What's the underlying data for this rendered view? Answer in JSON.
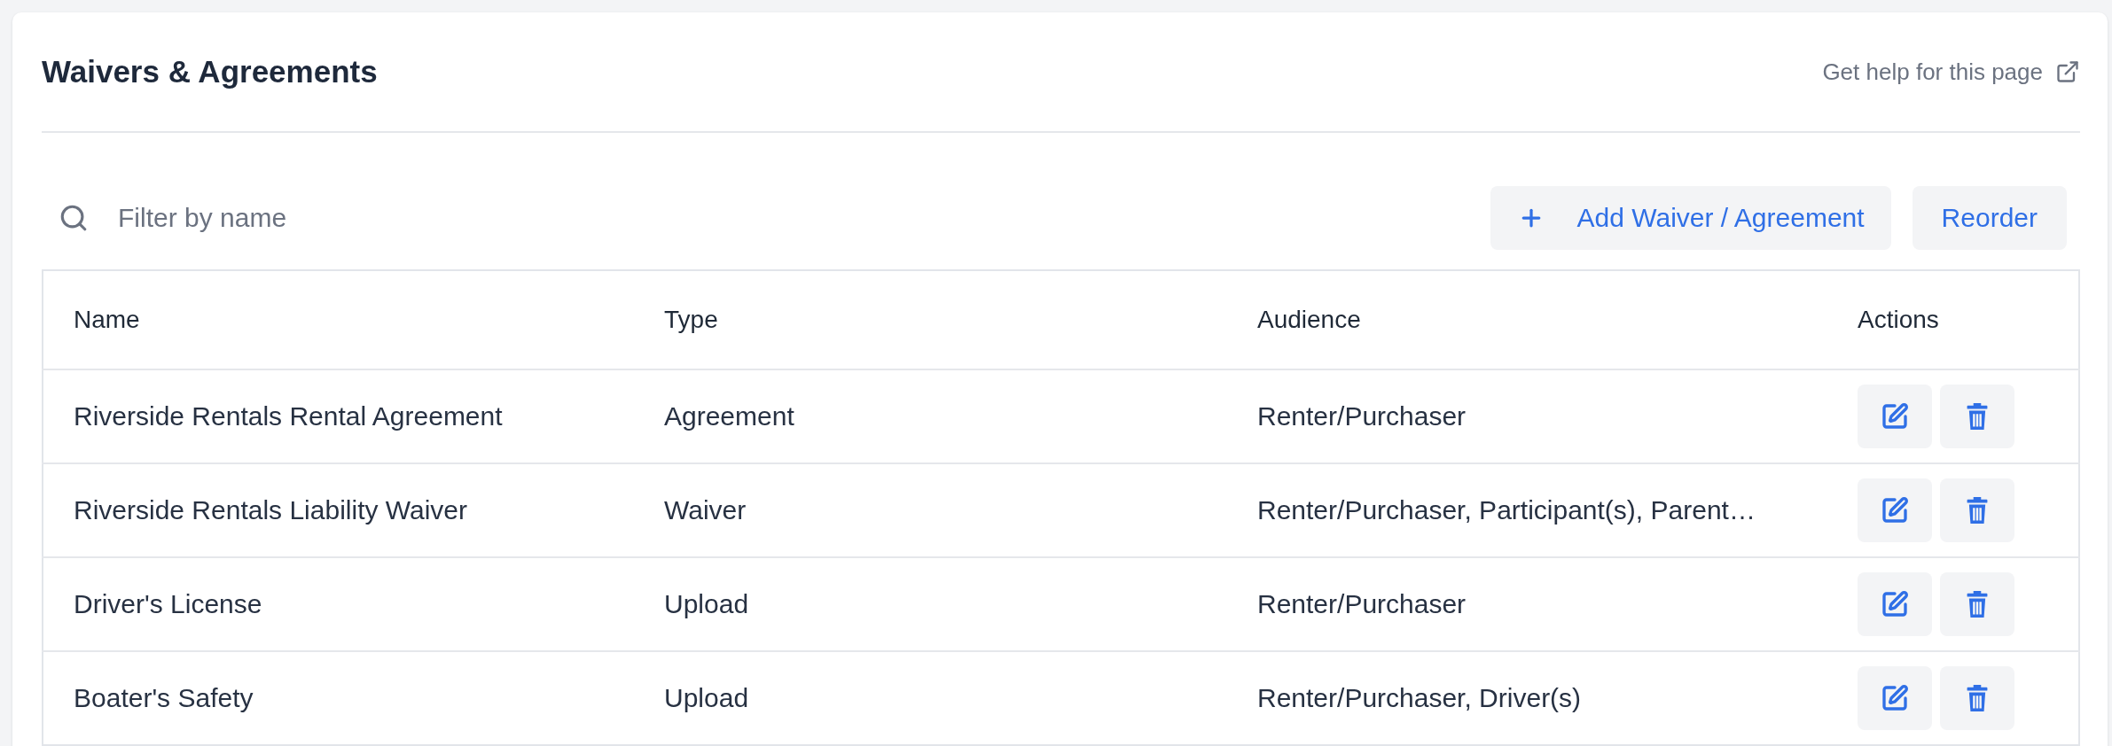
{
  "page": {
    "title": "Waivers & Agreements",
    "help_link": "Get help for this page"
  },
  "toolbar": {
    "search": {
      "placeholder": "Filter by name"
    },
    "buttons": [
      {
        "label": "Add Waiver / Agreement",
        "kind": "add"
      },
      {
        "label": "Reorder",
        "kind": "plain"
      }
    ]
  },
  "table": {
    "columns": [
      "Name",
      "Type",
      "Audience",
      "Actions"
    ],
    "rows": [
      {
        "name": "Riverside Rentals Rental Agreement",
        "type": "Agreement",
        "audience": "Renter/Purchaser"
      },
      {
        "name": "Riverside Rentals Liability Waiver",
        "type": "Waiver",
        "audience": "Renter/Purchaser, Participant(s), Parent…"
      },
      {
        "name": "Driver's License",
        "type": "Upload",
        "audience": "Renter/Purchaser"
      },
      {
        "name": "Boater's Safety",
        "type": "Upload",
        "audience": "Renter/Purchaser, Driver(s)"
      }
    ]
  }
}
